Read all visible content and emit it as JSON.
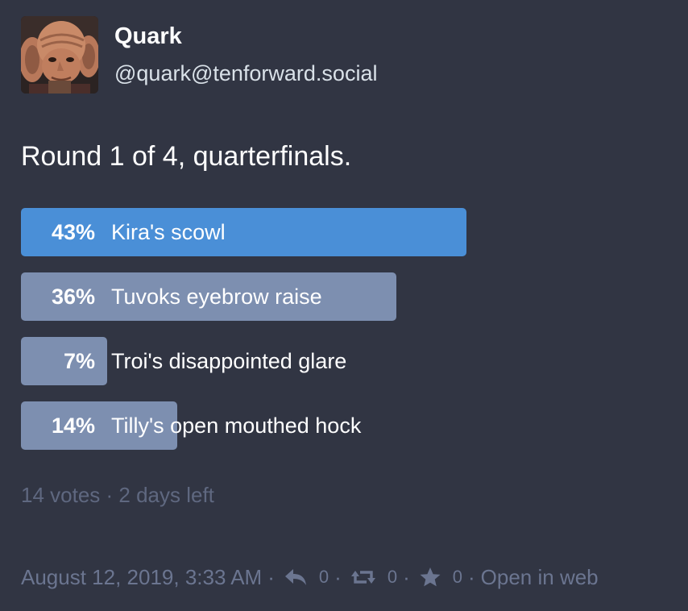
{
  "account": {
    "display_name": "Quark",
    "handle": "@quark@tenforward.social",
    "avatar_icon": "avatar-portrait"
  },
  "status": {
    "text": "Round 1 of 4, quarterfinals."
  },
  "poll": {
    "options": [
      {
        "percent_label": "43%",
        "label": "Kira's scowl",
        "value": 43,
        "leading": true
      },
      {
        "percent_label": "36%",
        "label": "Tuvoks eyebrow raise",
        "value": 36,
        "leading": false
      },
      {
        "percent_label": "7%",
        "label": "Troi's disappointed glare",
        "value": 7,
        "leading": false
      },
      {
        "percent_label": "14%",
        "label": "Tilly's open mouthed hock",
        "value": 14,
        "leading": false
      }
    ],
    "footer": "14 votes · 2 days left",
    "colors": {
      "leading": "#4a8fd7",
      "other": "#7d8fb0"
    }
  },
  "meta": {
    "timestamp": "August 12, 2019, 3:33 AM",
    "separator": "·",
    "reply_count": "0",
    "boost_count": "0",
    "favourite_count": "0",
    "open_in_web": "Open in web",
    "icons": {
      "reply": "reply-icon",
      "boost": "boost-icon",
      "favourite": "star-icon"
    }
  },
  "colors": {
    "background": "#313543",
    "muted_text": "#6b7590"
  }
}
